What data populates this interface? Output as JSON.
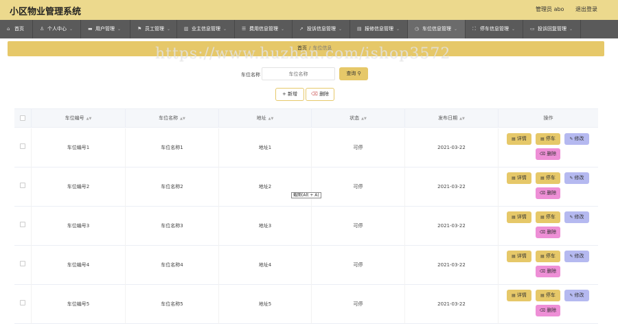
{
  "app": {
    "title": "小区物业管理系统",
    "user_label": "管理员 abo",
    "logout_label": "退出登录"
  },
  "nav": {
    "items": [
      {
        "icon": "home-icon",
        "label": "首页",
        "active": false
      },
      {
        "icon": "user-icon",
        "label": "个人中心",
        "active": false
      },
      {
        "icon": "users-icon",
        "label": "用户管理",
        "active": false
      },
      {
        "icon": "flag-icon",
        "label": "员工管理",
        "active": false
      },
      {
        "icon": "chart-icon",
        "label": "业主信息管理",
        "active": false
      },
      {
        "icon": "list-icon",
        "label": "费用信息管理",
        "active": false
      },
      {
        "icon": "send-icon",
        "label": "投诉信息管理",
        "active": false
      },
      {
        "icon": "doc-icon",
        "label": "报修信息管理",
        "active": false
      },
      {
        "icon": "clock-icon",
        "label": "车位信息管理",
        "active": true
      },
      {
        "icon": "expand-icon",
        "label": "停车信息管理",
        "active": false
      },
      {
        "icon": "card-icon",
        "label": "投诉回复管理",
        "active": false
      }
    ]
  },
  "breadcrumb": {
    "home": "首页",
    "separator": "/",
    "current": "车位信息"
  },
  "watermark": "https://www.huzhan.com/ishop3572",
  "search": {
    "label": "车位名称",
    "placeholder": "车位名称",
    "button_label": "查询"
  },
  "toolbar": {
    "add_label": "新增",
    "delete_label": "删除"
  },
  "table": {
    "columns": [
      "车位编号",
      "车位名称",
      "地址",
      "状态",
      "发布日期",
      "操作"
    ],
    "rows": [
      {
        "code": "车位编号1",
        "name": "车位名称1",
        "address": "地址1",
        "status": "可停",
        "date": "2021-03-22"
      },
      {
        "code": "车位编号2",
        "name": "车位名称2",
        "address": "地址2",
        "status": "可停",
        "date": "2021-03-22"
      },
      {
        "code": "车位编号3",
        "name": "车位名称3",
        "address": "地址3",
        "status": "可停",
        "date": "2021-03-22"
      },
      {
        "code": "车位编号4",
        "name": "车位名称4",
        "address": "地址4",
        "status": "可停",
        "date": "2021-03-22"
      },
      {
        "code": "车位编号5",
        "name": "车位名称5",
        "address": "地址5",
        "status": "可停",
        "date": "2021-03-22"
      }
    ],
    "actions": {
      "detail": "详情",
      "park": "停车",
      "edit": "修改",
      "remove": "删除"
    }
  },
  "tooltip": "截图(Alt + A)",
  "colors": {
    "accent": "#e6c869",
    "topbar": "#ecd98d",
    "navbar": "#5a5a5a",
    "edit_button": "#b5b9f0",
    "delete_button": "#ee8fd6"
  }
}
